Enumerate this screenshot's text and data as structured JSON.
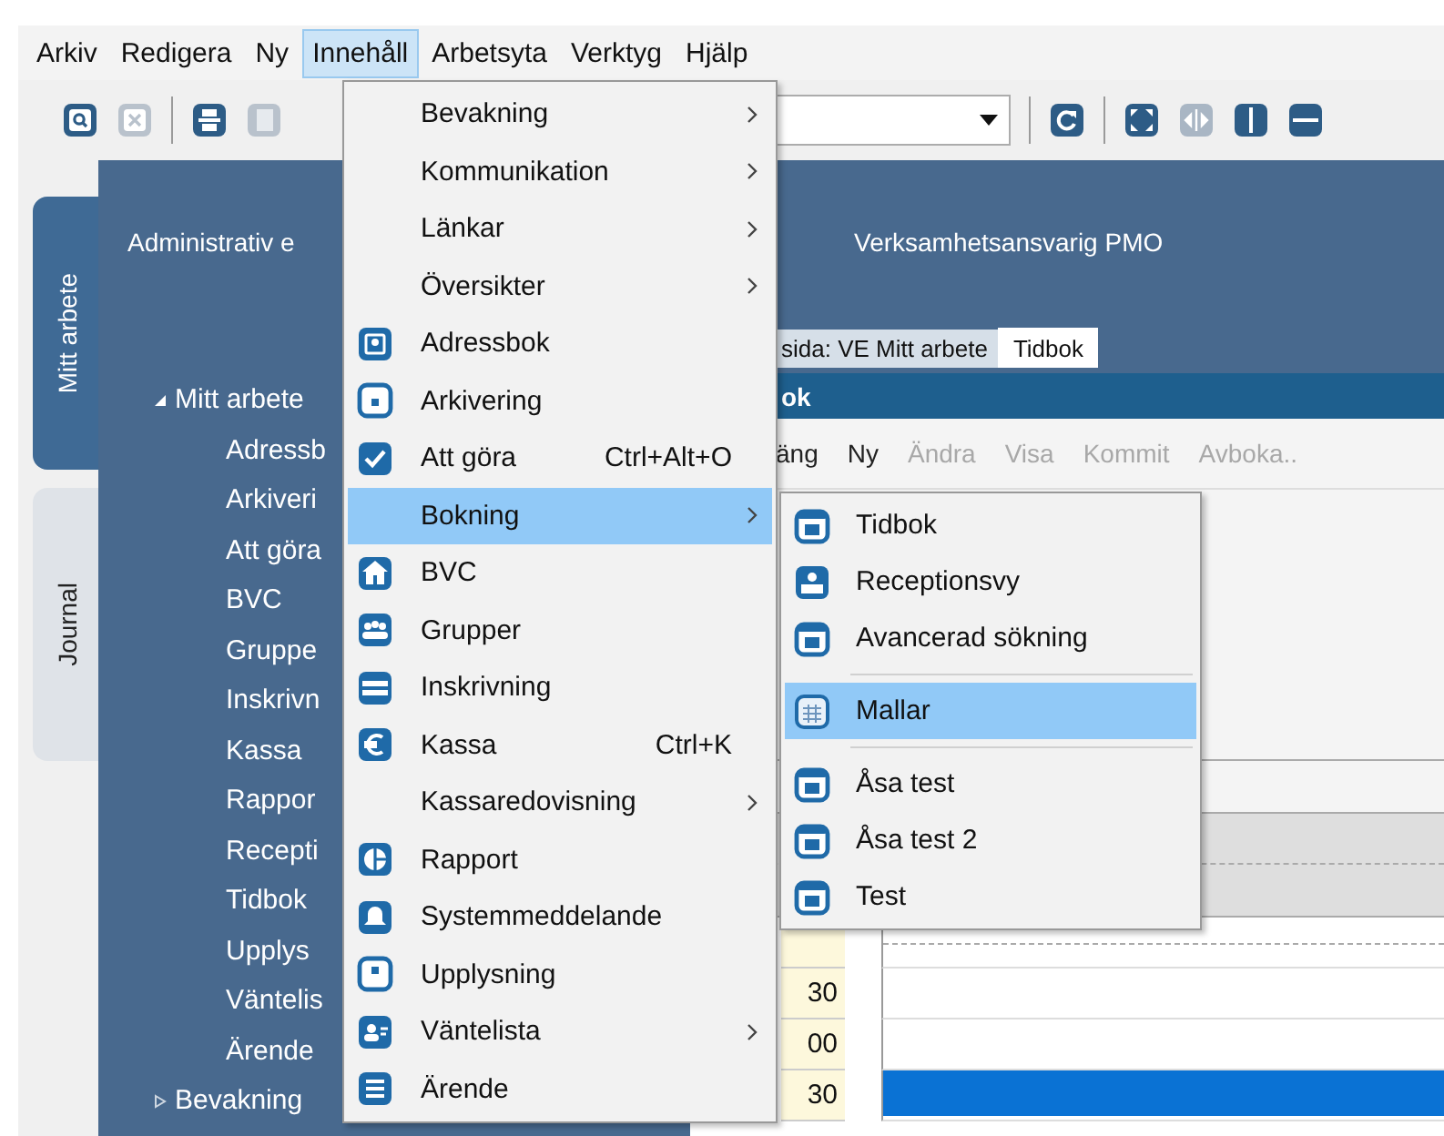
{
  "menubar": [
    {
      "label": "Arkiv",
      "selected": false
    },
    {
      "label": "Redigera",
      "selected": false
    },
    {
      "label": "Ny",
      "selected": false
    },
    {
      "label": "Innehåll",
      "selected": true
    },
    {
      "label": "Arbetsyta",
      "selected": false
    },
    {
      "label": "Verktyg",
      "selected": false
    },
    {
      "label": "Hjälp",
      "selected": false
    }
  ],
  "vertical_tabs": [
    {
      "label": "Mitt arbete",
      "selected": true
    },
    {
      "label": "Journal",
      "selected": false
    }
  ],
  "header": {
    "left_text": "Administrativ e",
    "right_text": "Verksamhetsansvarig PMO"
  },
  "tree": [
    {
      "label": "Mitt arbete",
      "expanded": true,
      "children": [
        {
          "label": "Adressb"
        },
        {
          "label": "Arkiveri"
        },
        {
          "label": "Att göra"
        },
        {
          "label": "BVC"
        },
        {
          "label": "Gruppe"
        },
        {
          "label": "Inskrivn"
        },
        {
          "label": "Kassa"
        },
        {
          "label": "Rappor"
        },
        {
          "label": "Recepti"
        },
        {
          "label": "Tidbok"
        },
        {
          "label": "Upplys"
        },
        {
          "label": "Väntelis"
        },
        {
          "label": "Ärende"
        }
      ]
    },
    {
      "label": "Bevakning",
      "expanded": false
    }
  ],
  "document_tabs": [
    {
      "label": "sida: VE Mitt arbete",
      "selected": false
    },
    {
      "label": "Tidbok",
      "selected": true
    }
  ],
  "window": {
    "title": "ok"
  },
  "window_toolbar": [
    {
      "label": "äng",
      "disabled": false
    },
    {
      "label": "Ny",
      "disabled": false
    },
    {
      "label": "Ändra",
      "disabled": true
    },
    {
      "label": "Visa",
      "disabled": true
    },
    {
      "label": "Kommit",
      "disabled": true
    },
    {
      "label": "Avboka..",
      "disabled": true
    }
  ],
  "time_rows": [
    {
      "label": "30",
      "booked": false
    },
    {
      "label": "00",
      "booked": false
    },
    {
      "label": "30",
      "booked": true
    }
  ],
  "menu": [
    {
      "label": "Bevakning",
      "has_icon": false,
      "submenu": true,
      "selected": false
    },
    {
      "label": "Kommunikation",
      "has_icon": false,
      "submenu": true,
      "selected": false
    },
    {
      "label": "Länkar",
      "has_icon": false,
      "submenu": true,
      "selected": false
    },
    {
      "label": "Översikter",
      "has_icon": false,
      "submenu": true,
      "selected": false
    },
    {
      "label": "Adressbok",
      "has_icon": true,
      "submenu": false,
      "selected": false
    },
    {
      "label": "Arkivering",
      "has_icon": true,
      "submenu": false,
      "selected": false
    },
    {
      "label": "Att göra",
      "shortcut": "Ctrl+Alt+O",
      "has_icon": true,
      "submenu": false,
      "selected": false
    },
    {
      "label": "Bokning",
      "has_icon": false,
      "submenu": true,
      "selected": true
    },
    {
      "label": "BVC",
      "has_icon": true,
      "submenu": false,
      "selected": false
    },
    {
      "label": "Grupper",
      "has_icon": true,
      "submenu": false,
      "selected": false
    },
    {
      "label": "Inskrivning",
      "has_icon": true,
      "submenu": false,
      "selected": false
    },
    {
      "label": "Kassa",
      "shortcut": "Ctrl+K",
      "has_icon": true,
      "submenu": false,
      "selected": false
    },
    {
      "label": "Kassaredovisning",
      "has_icon": false,
      "submenu": true,
      "selected": false
    },
    {
      "label": "Rapport",
      "has_icon": true,
      "submenu": false,
      "selected": false
    },
    {
      "label": "Systemmeddelande",
      "has_icon": true,
      "submenu": false,
      "selected": false
    },
    {
      "label": "Upplysning",
      "has_icon": true,
      "submenu": false,
      "selected": false
    },
    {
      "label": "Väntelista",
      "has_icon": true,
      "submenu": true,
      "selected": false
    },
    {
      "label": "Ärende",
      "has_icon": true,
      "submenu": false,
      "selected": false
    }
  ],
  "submenu": [
    {
      "kind": "item",
      "label": "Tidbok",
      "selected": false
    },
    {
      "kind": "item",
      "label": "Receptionsvy",
      "selected": false
    },
    {
      "kind": "item",
      "label": "Avancerad sökning",
      "selected": false
    },
    {
      "kind": "separator"
    },
    {
      "kind": "item",
      "label": "Mallar",
      "selected": true
    },
    {
      "kind": "separator"
    },
    {
      "kind": "item",
      "label": "Åsa test",
      "selected": false
    },
    {
      "kind": "item",
      "label": "Åsa test 2",
      "selected": false
    },
    {
      "kind": "item",
      "label": "Test",
      "selected": false
    }
  ]
}
